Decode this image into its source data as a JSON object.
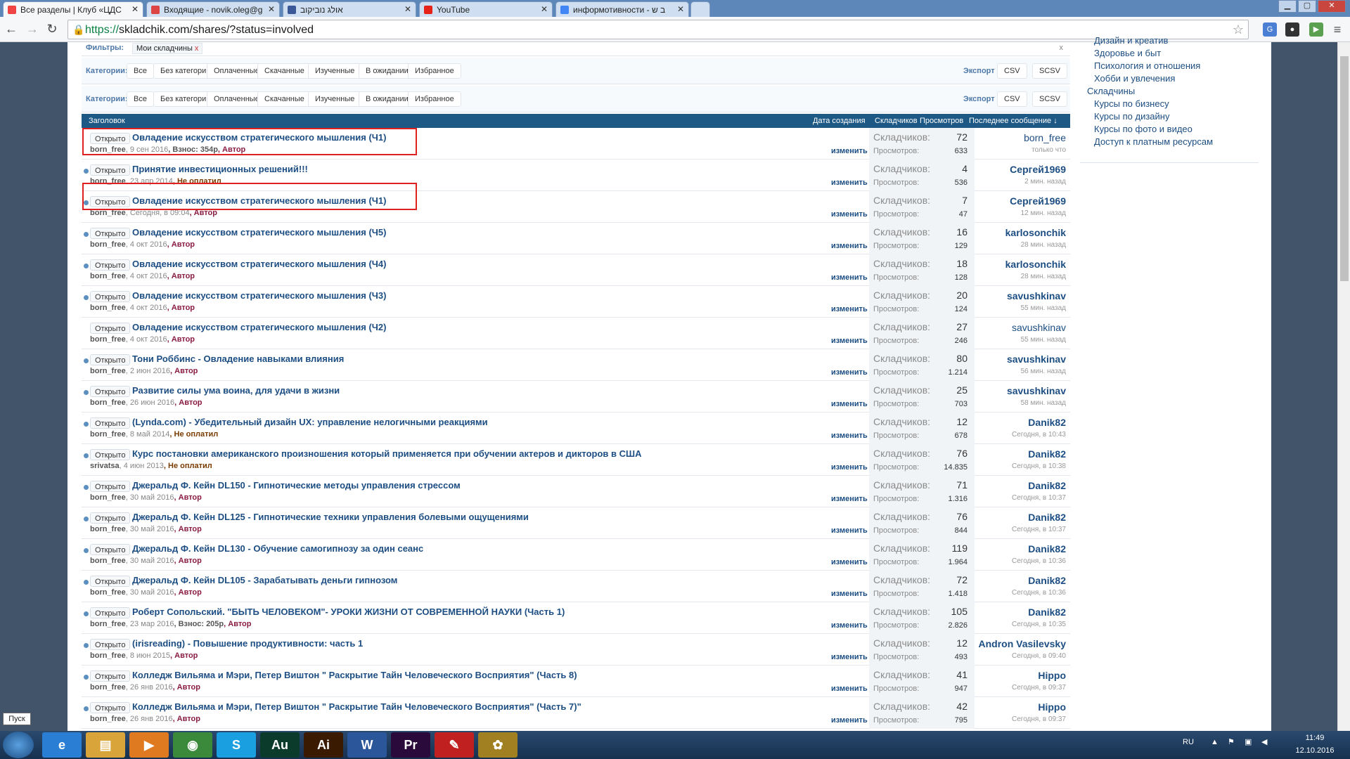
{
  "tabs": [
    {
      "label": "Все разделы | Клуб «ЦДС",
      "icon": "chrome-icon",
      "color": "#e44"
    },
    {
      "label": "Входящие - novik.oleg@g",
      "icon": "gmail-icon",
      "color": "#d44"
    },
    {
      "label": "אולג נוביקוב",
      "icon": "facebook-icon",
      "color": "#3b5998"
    },
    {
      "label": "YouTube",
      "icon": "youtube-icon",
      "color": "#e62117"
    },
    {
      "label": "информотивности - ב ש",
      "icon": "google-icon",
      "color": "#4285f4"
    }
  ],
  "address": {
    "scheme": "https://",
    "rest": "skladchik.com/shares/?status=involved"
  },
  "filters": {
    "label": "Фильтры:",
    "chip": "Мои складчины",
    "chip_close": "x",
    "close": "x"
  },
  "categories_label": "Категории:",
  "categories": [
    "Все",
    "Без категории",
    "Оплаченные",
    "Скачанные",
    "Изученные",
    "В ожидании",
    "Избранное"
  ],
  "export": {
    "label": "Экспорт",
    "csv": "CSV",
    "scsv": "SCSV"
  },
  "table_header": {
    "title": "Заголовок",
    "created": "Дата создания",
    "members": "Складчиков",
    "views": "Просмотров",
    "last": "Последнее сообщение ↓"
  },
  "labels": {
    "open": "Открыто",
    "edit": "изменить",
    "members": "Складчиков:",
    "views": "Просмотров:"
  },
  "rows": [
    {
      "title": "Овладение искусством стратегического мышления (Ч1)",
      "user": "born_free",
      "date": ", 9 сен 2016",
      "extra": ", Взнос: 354р",
      "status": ", Автор",
      "status_type": "a",
      "members": "72",
      "views": "633",
      "last_user": "born_free",
      "last_plain": true,
      "last_time": "только что",
      "dot": false
    },
    {
      "title": "Принятие инвестиционных решений!!!",
      "user": "born_free",
      "date": ", 23 апр 2014",
      "extra": "",
      "status": ", Не оплатил",
      "status_type": "n",
      "members": "4",
      "views": "536",
      "last_user": "Сергей1969",
      "last_plain": false,
      "last_time": "2 мин. назад",
      "dot": true
    },
    {
      "title": "Овладение искусством стратегического мышления (Ч1)",
      "user": "born_free",
      "date": ", Сегодня, в 09:04",
      "extra": "",
      "status": ", Автор",
      "status_type": "a",
      "members": "7",
      "views": "47",
      "last_user": "Сергей1969",
      "last_plain": false,
      "last_time": "12 мин. назад",
      "dot": true
    },
    {
      "title": "Овладение искусством стратегического мышления (Ч5)",
      "user": "born_free",
      "date": ", 4 окт 2016",
      "extra": "",
      "status": ", Автор",
      "status_type": "a",
      "members": "16",
      "views": "129",
      "last_user": "karlosonchik",
      "last_plain": false,
      "last_time": "28 мин. назад",
      "dot": true
    },
    {
      "title": "Овладение искусством стратегического мышления (Ч4)",
      "user": "born_free",
      "date": ", 4 окт 2016",
      "extra": "",
      "status": ", Автор",
      "status_type": "a",
      "members": "18",
      "views": "128",
      "last_user": "karlosonchik",
      "last_plain": false,
      "last_time": "28 мин. назад",
      "dot": true
    },
    {
      "title": "Овладение искусством стратегического мышления (Ч3)",
      "user": "born_free",
      "date": ", 4 окт 2016",
      "extra": "",
      "status": ", Автор",
      "status_type": "a",
      "members": "20",
      "views": "124",
      "last_user": "savushkinav",
      "last_plain": false,
      "last_time": "55 мин. назад",
      "dot": true
    },
    {
      "title": "Овладение искусством стратегического мышления (Ч2)",
      "user": "born_free",
      "date": ", 4 окт 2016",
      "extra": "",
      "status": ", Автор",
      "status_type": "a",
      "members": "27",
      "views": "246",
      "last_user": "savushkinav",
      "last_plain": true,
      "last_time": "55 мин. назад",
      "dot": false
    },
    {
      "title": "Тони Роббинс - Овладение навыками влияния",
      "user": "born_free",
      "date": ", 2 июн 2016",
      "extra": "",
      "status": ", Автор",
      "status_type": "a",
      "members": "80",
      "views": "1.214",
      "last_user": "savushkinav",
      "last_plain": false,
      "last_time": "56 мин. назад",
      "dot": true
    },
    {
      "title": "Развитие силы ума воина, для удачи в жизни",
      "user": "born_free",
      "date": ", 26 июн 2016",
      "extra": "",
      "status": ", Автор",
      "status_type": "a",
      "members": "25",
      "views": "703",
      "last_user": "savushkinav",
      "last_plain": false,
      "last_time": "58 мин. назад",
      "dot": true
    },
    {
      "title": "(Lynda.com) - Убедительный дизайн UX: управление нелогичными реакциями",
      "user": "born_free",
      "date": ", 8 май 2014",
      "extra": "",
      "status": ", Не оплатил",
      "status_type": "n",
      "members": "12",
      "views": "678",
      "last_user": "Danik82",
      "last_plain": false,
      "last_time": "Сегодня, в 10:43",
      "dot": true
    },
    {
      "title": "Курс постановки американского произношения который применяется при обучении актеров и дикторов в США",
      "user": "srivatsa",
      "date": ", 4 июн 2013",
      "extra": "",
      "status": ", Не оплатил",
      "status_type": "n",
      "members": "76",
      "views": "14.835",
      "last_user": "Danik82",
      "last_plain": false,
      "last_time": "Сегодня, в 10:38",
      "dot": true
    },
    {
      "title": "Джеральд Ф. Кейн DL150 - Гипнотические методы управления стрессом",
      "user": "born_free",
      "date": ", 30 май 2016",
      "extra": "",
      "status": ", Автор",
      "status_type": "a",
      "members": "71",
      "views": "1.316",
      "last_user": "Danik82",
      "last_plain": false,
      "last_time": "Сегодня, в 10:37",
      "dot": true
    },
    {
      "title": "Джеральд Ф. Кейн DL125 - Гипнотические техники управления болевыми ощущениями",
      "user": "born_free",
      "date": ", 30 май 2016",
      "extra": "",
      "status": ", Автор",
      "status_type": "a",
      "members": "76",
      "views": "844",
      "last_user": "Danik82",
      "last_plain": false,
      "last_time": "Сегодня, в 10:37",
      "dot": true
    },
    {
      "title": "Джеральд Ф. Кейн DL130 - Обучение самогипнозу за один сеанс",
      "user": "born_free",
      "date": ", 30 май 2016",
      "extra": "",
      "status": ", Автор",
      "status_type": "a",
      "members": "119",
      "views": "1.964",
      "last_user": "Danik82",
      "last_plain": false,
      "last_time": "Сегодня, в 10:36",
      "dot": true
    },
    {
      "title": "Джеральд Ф. Кейн DL105 - Зарабатывать деньги гипнозом",
      "user": "born_free",
      "date": ", 30 май 2016",
      "extra": "",
      "status": ", Автор",
      "status_type": "a",
      "members": "72",
      "views": "1.418",
      "last_user": "Danik82",
      "last_plain": false,
      "last_time": "Сегодня, в 10:36",
      "dot": true
    },
    {
      "title": "Роберт Сопольский. \"БЫТЬ ЧЕЛОВЕКОМ\"- УРОКИ ЖИЗНИ ОТ СОВРЕМЕННОЙ НАУКИ (Часть 1)",
      "user": "born_free",
      "date": ", 23 мар 2016",
      "extra": ", Взнос: 205р",
      "status": ", Автор",
      "status_type": "a",
      "members": "105",
      "views": "2.826",
      "last_user": "Danik82",
      "last_plain": false,
      "last_time": "Сегодня, в 10:35",
      "dot": true
    },
    {
      "title": "(irisreading) - Повышение продуктивности: часть 1",
      "user": "born_free",
      "date": ", 8 июн 2015",
      "extra": "",
      "status": ", Автор",
      "status_type": "a",
      "members": "12",
      "views": "493",
      "last_user": "Andron Vasilevsky",
      "last_plain": false,
      "last_time": "Сегодня, в 09:40",
      "dot": true
    },
    {
      "title": "Колледж Вильяма и Мэри, Петер Виштон \" Раскрытие Тайн Человеческого Восприятия\" (Часть 8)",
      "user": "born_free",
      "date": ", 26 янв 2016",
      "extra": "",
      "status": ", Автор",
      "status_type": "a",
      "members": "41",
      "views": "947",
      "last_user": "Hippo",
      "last_plain": false,
      "last_time": "Сегодня, в 09:37",
      "dot": true
    },
    {
      "title": "Колледж Вильяма и Мэри, Петер Виштон \" Раскрытие Тайн Человеческого Восприятия\" (Часть 7)\"",
      "user": "born_free",
      "date": ", 26 янв 2016",
      "extra": "",
      "status": ", Автор",
      "status_type": "a",
      "members": "42",
      "views": "795",
      "last_user": "Hippo",
      "last_plain": false,
      "last_time": "Сегодня, в 09:37",
      "dot": true
    }
  ],
  "sidebar": {
    "items_top": [
      "Дизайн и креатив",
      "Здоровье и быт",
      "Психология и отношения",
      "Хобби и увлечения"
    ],
    "heading": "Складчины",
    "items_bottom": [
      "Курсы по бизнесу",
      "Курсы по дизайну",
      "Курсы по фото и видео",
      "Доступ к платным ресурсам"
    ]
  },
  "taskbar": {
    "start_tooltip": "Пуск",
    "apps": [
      {
        "name": "ie",
        "glyph": "e"
      },
      {
        "name": "explorer",
        "glyph": "▤"
      },
      {
        "name": "media-player",
        "glyph": "▶"
      },
      {
        "name": "chrome",
        "glyph": "◉"
      },
      {
        "name": "skype",
        "glyph": "S"
      },
      {
        "name": "audition",
        "glyph": "Au"
      },
      {
        "name": "illustrator",
        "glyph": "Ai"
      },
      {
        "name": "word",
        "glyph": "W"
      },
      {
        "name": "premiere",
        "glyph": "Pr"
      },
      {
        "name": "acrobat",
        "glyph": "✎"
      },
      {
        "name": "app",
        "glyph": "✿"
      }
    ],
    "lang": "RU",
    "time": "11:49",
    "date": "12.10.2016"
  }
}
